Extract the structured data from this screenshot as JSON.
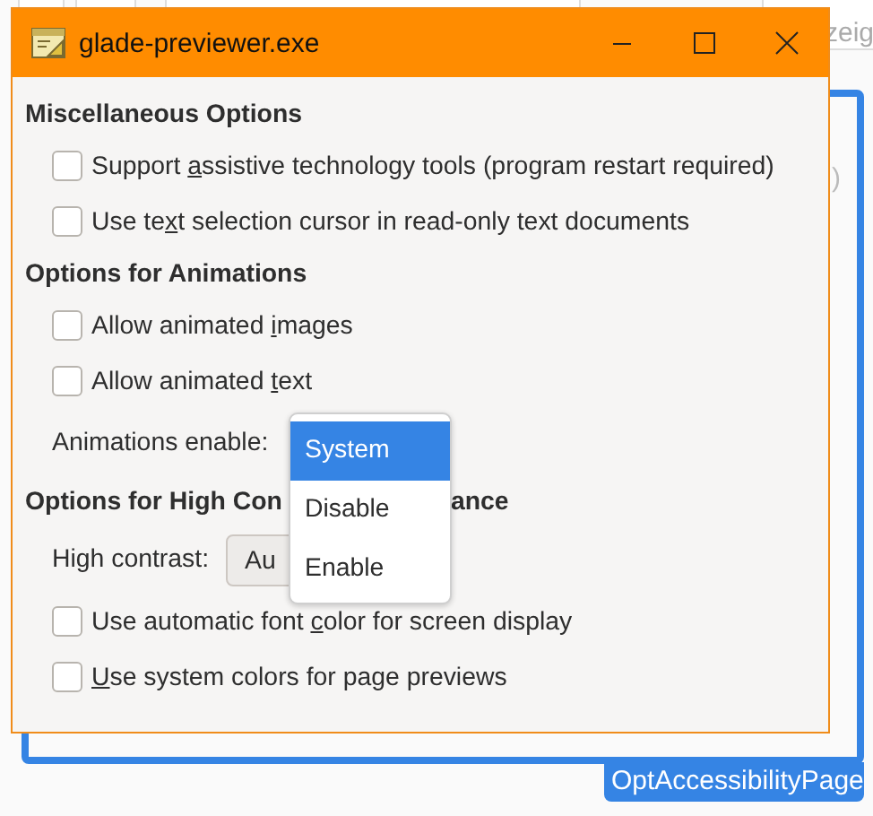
{
  "background": {
    "toolbar_text": "zeig",
    "fragment": ")",
    "page_label": "OptAccessibilityPage"
  },
  "window": {
    "title": "glade-previewer.exe"
  },
  "sections": [
    {
      "heading": "Miscellaneous Options",
      "rows": [
        {
          "kind": "checkbox",
          "label_before": "Support ",
          "mnemonic": "a",
          "label_after": "ssistive technology tools (program restart required)",
          "checked": false
        },
        {
          "kind": "checkbox",
          "label_before": "Use te",
          "mnemonic": "x",
          "label_after": "t selection cursor in read-only text documents",
          "checked": false
        }
      ]
    },
    {
      "heading": "Options for Animations",
      "rows": [
        {
          "kind": "checkbox",
          "label_before": "Allow animated ",
          "mnemonic": "i",
          "label_after": "mages",
          "checked": false
        },
        {
          "kind": "checkbox",
          "label_before": "Allow animated ",
          "mnemonic": "t",
          "label_after": "ext",
          "checked": false
        },
        {
          "kind": "combo",
          "label": "Animations enable:"
        }
      ]
    },
    {
      "heading": "Options for High Con",
      "heading_rest": "ance",
      "rows": [
        {
          "kind": "combo",
          "label": "High contrast:",
          "value": "Au"
        },
        {
          "kind": "checkbox",
          "label_before": "Use automatic font ",
          "mnemonic": "c",
          "label_after": "olor for screen display",
          "checked": false
        },
        {
          "kind": "checkbox",
          "mnemonic": "U",
          "label_after": "se system colors for page previews",
          "checked": false
        }
      ]
    }
  ],
  "popup": {
    "items": [
      {
        "label": "System",
        "selected": true
      },
      {
        "label": "Disable",
        "selected": false
      },
      {
        "label": "Enable",
        "selected": false
      }
    ]
  }
}
